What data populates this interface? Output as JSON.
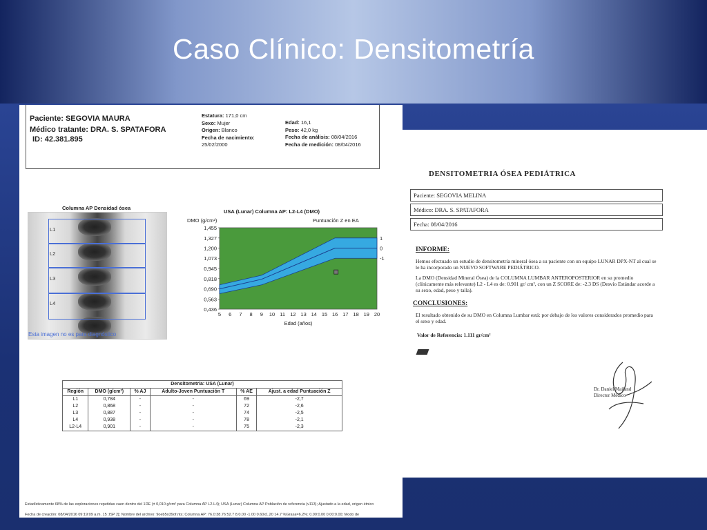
{
  "slide": {
    "title": "Caso Clínico: Densitometría"
  },
  "report_left": {
    "patient": "Paciente: SEGOVIA MAURA",
    "doctor": "Médico tratante:  DRA. S. SPATAFORA",
    "id": "ID: 42.381.895",
    "estatura_label": "Estatura:",
    "estatura": "171,0 cm",
    "sexo_label": "Sexo:",
    "sexo": "Mujer",
    "origen_label": "Origen:",
    "origen": "Blanco",
    "nacimiento_label": "Fecha de nacimiento:",
    "nacimiento": "25/02/2000",
    "edad_label": "Edad:",
    "edad": "16,1",
    "peso_label": "Peso:",
    "peso": "42,0 kg",
    "analisis_label": "Fecha de análisis:",
    "analisis": "08/04/2016",
    "medicion_label": "Fecha de medición:",
    "medicion": "08/04/2016",
    "image_title": "Columna AP Densidad ósea",
    "image_caption": "Esta imagen no es para diagnóstico",
    "roi_labels": [
      "L1",
      "L2",
      "L3",
      "L4"
    ],
    "footnote1": "Estadísticamente 68% de las exploraciones repetidas caen dentro del  1DE (± 0,010 g/cm² para Columna AP L2-L4); USA (Lunar) Columna AP Población de referencia (v113); Ajustado a la edad, origen étnico",
    "footnote2": "Fecha de creación: 08/04/2016 09:19:09 a.m. 15 ;ISP 2]; Nombre del archivo: 9oeb5o39of.nts;  Columna AP: 76.0:38.76:52.7 8.0.00 -1.00 0.60x1.20 14.7 %Grasa=6.2%; 0.00:0.00 0.00:0.00; Modo de"
  },
  "chart_data": {
    "type": "area",
    "title": "USA (Lunar) Columna AP: L2-L4 (DMO)",
    "ylabel": "DMO (g/cm²)",
    "xlabel": "Edad (años)",
    "right_axis_label": "Puntuación Z en EA",
    "x_ticks": [
      5,
      6,
      7,
      8,
      9,
      10,
      11,
      12,
      13,
      14,
      15,
      16,
      17,
      18,
      19,
      20
    ],
    "y_ticks": [
      "0,436",
      "0,563",
      "0,690",
      "0,818",
      "0,945",
      "1,073",
      "1,200",
      "1,327",
      "1,455"
    ],
    "z_ticks": [
      "1",
      "0",
      "-1"
    ],
    "xlim": [
      5,
      20
    ],
    "ylim": [
      0.436,
      1.455
    ],
    "band_x": [
      5,
      9,
      16,
      20
    ],
    "band_upper": [
      0.74,
      0.86,
      1.327,
      1.327
    ],
    "band_mean": [
      0.69,
      0.81,
      1.2,
      1.2
    ],
    "band_lower": [
      0.63,
      0.74,
      1.073,
      1.073
    ],
    "patient_point": {
      "x": 16.1,
      "y": 0.901
    },
    "colors": {
      "background": "#4a9a3c",
      "band": "#36a9e1",
      "line": "#1b3f8f"
    }
  },
  "table": {
    "title": "Densitometría: USA (Lunar)",
    "headers": [
      "Región",
      "DMO (g/cm²)",
      "% AJ",
      "Adulto-Joven Puntuación T",
      "% AE",
      "Ajust. a edad Puntuación Z"
    ],
    "rows": [
      [
        "L1",
        "0,784",
        "-",
        "-",
        "69",
        "-2,7"
      ],
      [
        "L2",
        "0,868",
        "-",
        "-",
        "72",
        "-2,6"
      ],
      [
        "L3",
        "0,887",
        "-",
        "-",
        "74",
        "-2,5"
      ],
      [
        "L4",
        "0,938",
        "-",
        "-",
        "78",
        "-2,1"
      ],
      [
        "L2-L4",
        "0,901",
        "-",
        "-",
        "75",
        "-2,3"
      ]
    ]
  },
  "report_right": {
    "title": "DENSITOMETRIA ÓSEA PEDIÁTRICA",
    "paciente": "Paciente:   SEGOVIA MELINA",
    "medico": "Médico: DRA. S. SPATAFORA",
    "fecha": "Fecha:    08/04/2016",
    "informe_h": "INFORME:",
    "informe_p1": "Hemos efectuado un estudio de densitometría mineral ósea a su paciente con un equipo LUNAR DPX-NT al cual se le ha incorporado un NUEVO SOFTWARE PEDIÁTRICO.",
    "informe_p2": "La DMO (Densidad Mineral Ósea) de la COLUMNA LUMBAR ANTEROPOSTERIOR en su promedio (clínicamente más relevante)  L2 - L4 es de: 0.901 gr/ cm², con un Z SCORE de: -2.3 DS (Desvío Estándar acorde a su sexo, edad, peso y talla).",
    "conclusiones_h": "CONCLUSIONES:",
    "conclusiones_p": "El resultado obtenido de su DMO en Columna Lumbar está: por debajo de los valores considerados promedio para el sexo y edad.",
    "referencia": "Valor de Referencia:   1.111  gr/cm²",
    "signature_name": "Dr. Daniel Mailand",
    "signature_role": "Director Médico"
  }
}
